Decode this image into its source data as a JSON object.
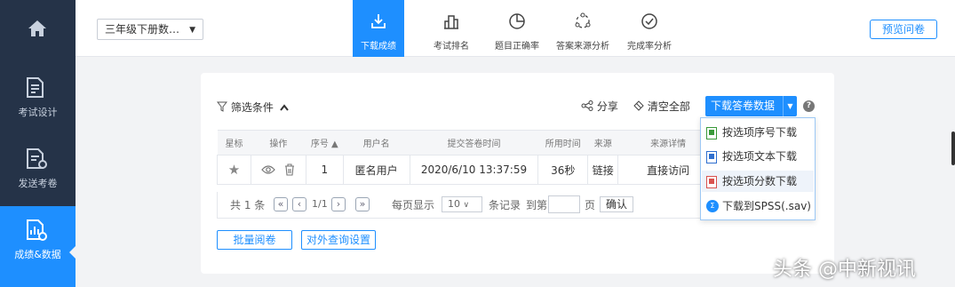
{
  "sidebar": {
    "items": [
      {
        "icon": "home-icon",
        "label": ""
      },
      {
        "icon": "exam-design-icon",
        "label": "考试设计"
      },
      {
        "icon": "send-exam-icon",
        "label": "发送考卷"
      },
      {
        "icon": "results-data-icon",
        "label": "成绩&数据"
      }
    ],
    "active_index": 3
  },
  "topbar": {
    "survey_select": "三年级下册数…",
    "tabs": [
      {
        "icon": "download-icon",
        "label": "下载成绩",
        "active": true
      },
      {
        "icon": "ranking-icon",
        "label": "考试排名",
        "active": false
      },
      {
        "icon": "pie-icon",
        "label": "题目正确率",
        "active": false
      },
      {
        "icon": "source-icon",
        "label": "答案来源分析",
        "active": false
      },
      {
        "icon": "check-circle-icon",
        "label": "完成率分析",
        "active": false
      }
    ],
    "preview_label": "预览问卷"
  },
  "panel": {
    "filter_label": "筛选条件",
    "share_label": "分享",
    "clear_label": "清空全部",
    "download_label": "下载答卷数据",
    "table": {
      "headers": [
        "星标",
        "操作",
        "序号 ▲",
        "用户名",
        "提交答卷时间",
        "所用时间",
        "来源",
        "来源详情"
      ],
      "rows": [
        {
          "star": "★",
          "seq": "1",
          "user": "匿名用户",
          "time": "2020/6/10 13:37:59",
          "used": "36秒",
          "source": "链接",
          "detail": "直接访问"
        }
      ]
    },
    "pager": {
      "total": "共 1 条",
      "page": "1/1",
      "per_page_label": "每页显示",
      "page_size": "10",
      "records_label": "条记录",
      "goto_label": "到第",
      "page_unit": "页",
      "confirm": "确认"
    },
    "batch_label": "批量阅卷",
    "external_label": "对外查询设置"
  },
  "dropdown": {
    "items": [
      {
        "label": "按选项序号下载",
        "icon": "excel-file-icon",
        "color": "#3a9a3a"
      },
      {
        "label": "按选项文本下载",
        "icon": "excel-file-icon",
        "color": "#2f6fcf"
      },
      {
        "label": "按选项分数下载",
        "icon": "excel-file-icon",
        "color": "#d9534f"
      },
      {
        "label": "下载到SPSS(.sav)",
        "icon": "spss-icon",
        "color": "#1e8fff"
      }
    ]
  },
  "watermark": "头条 @中新视讯",
  "colors": {
    "accent": "#1e8fff",
    "sidebar": "#253348"
  }
}
